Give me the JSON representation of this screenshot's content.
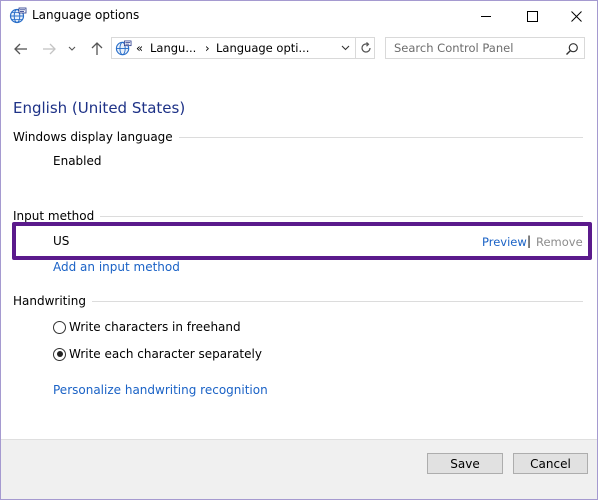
{
  "window": {
    "title": "Language options"
  },
  "nav": {
    "address_chevrons": "«",
    "address_segment_1": "Langu...",
    "address_separator": "›",
    "address_segment_2": "Language opti...",
    "search_placeholder": "Search Control Panel"
  },
  "page": {
    "title": "English (United States)"
  },
  "display_language": {
    "heading": "Windows display language",
    "status": "Enabled"
  },
  "input_method": {
    "heading": "Input method",
    "method": "US",
    "preview_label": "Preview",
    "separator": "|",
    "remove_label": "Remove",
    "add_label": "Add an input method"
  },
  "handwriting": {
    "heading": "Handwriting",
    "options": [
      {
        "label": "Write characters in freehand",
        "selected": false
      },
      {
        "label": "Write each character separately",
        "selected": true
      }
    ],
    "personalize_label": "Personalize handwriting recognition"
  },
  "footer": {
    "save_label": "Save",
    "cancel_label": "Cancel"
  },
  "colors": {
    "highlight_border": "#5b1a8c",
    "link": "#1a62c6",
    "title": "#1e3287"
  }
}
